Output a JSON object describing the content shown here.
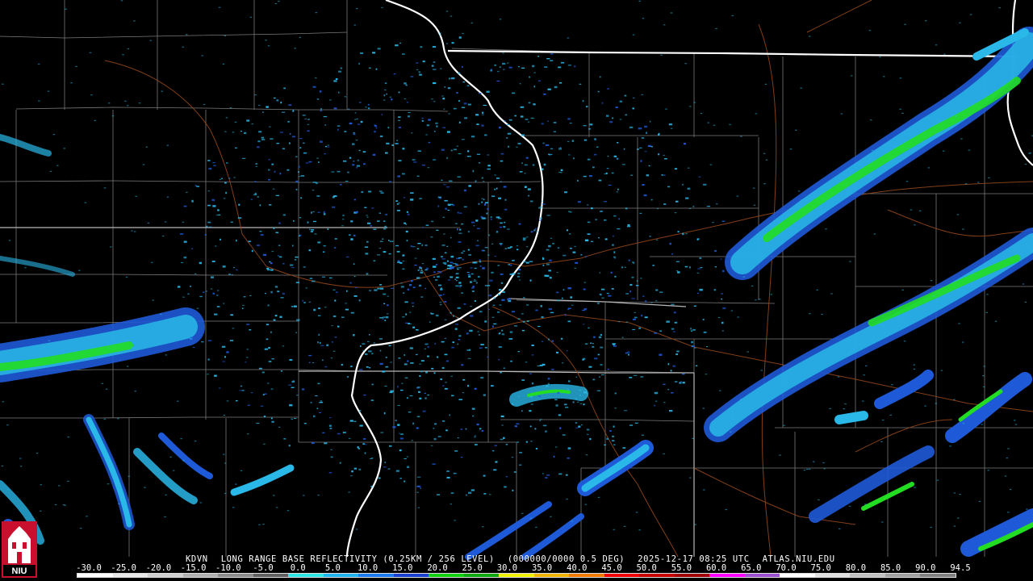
{
  "caption": {
    "station": "KDVN",
    "product": "LONG RANGE BASE REFLECTIVITY (0.25KM / 256 LEVEL)",
    "code": "(000000/0000 0.5 DEG)",
    "datetime": "2025-12-17 08:25 UTC",
    "site": "ATLAS.NIU.EDU"
  },
  "logo": {
    "name": "niu-logo",
    "text": "NIU"
  },
  "legend": {
    "ticks": [
      "-30.0",
      "-25.0",
      "-20.0",
      "-15.0",
      "-10.0",
      "-5.0",
      "0.0",
      "5.0",
      "10.0",
      "15.0",
      "20.0",
      "25.0",
      "30.0",
      "35.0",
      "40.0",
      "45.0",
      "50.0",
      "55.0",
      "60.0",
      "65.0",
      "70.0",
      "75.0",
      "80.0",
      "85.0",
      "90.0",
      "94.5"
    ],
    "colors": [
      "#ffffff",
      "#e8e8e8",
      "#cfcfcf",
      "#b0b0b0",
      "#8c8c8c",
      "#606060",
      "#2ee6e6",
      "#1fb4f0",
      "#1a7af0",
      "#1a40d0",
      "#10d010",
      "#10a810",
      "#f0f000",
      "#f0b400",
      "#f07a00",
      "#f00000",
      "#c80000",
      "#a00000",
      "#ff00ff",
      "#9a50d0",
      "#ffffff",
      "#e0e0e0",
      "#c0c0c0",
      "#a0a0a0",
      "#808080"
    ]
  },
  "palette": {
    "state_border": "#8a8a8a",
    "river": "#ffffff",
    "roads": "#9a4a1c",
    "echo_light": "#29b8e8",
    "echo_mid": "#1e5ad8",
    "echo_strong": "#22dd22"
  }
}
